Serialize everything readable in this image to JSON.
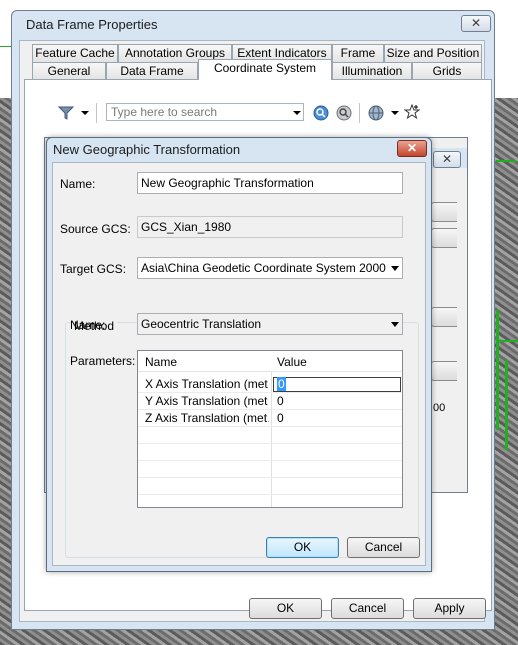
{
  "main_window": {
    "title": "Data Frame Properties",
    "close_glyph": "✕",
    "tabs_row1": [
      "Feature Cache",
      "Annotation Groups",
      "Extent Indicators",
      "Frame",
      "Size and Position"
    ],
    "tabs_row2": [
      "General",
      "Data Frame",
      "Coordinate System",
      "Illumination",
      "Grids"
    ],
    "active_tab": "Coordinate System",
    "search": {
      "placeholder": "Type here to search"
    },
    "toolbar_icons": [
      "filter-icon",
      "search-icon",
      "clear-search-icon",
      "globe-icon",
      "add-favorite-icon"
    ],
    "buttons": {
      "ok": "OK",
      "cancel": "Cancel",
      "apply": "Apply"
    }
  },
  "background_dialog": {
    "close_glyph": "✕",
    "partial_text": "00"
  },
  "transformation_dialog": {
    "title": "New Geographic Transformation",
    "close_glyph": "✕",
    "name_label": "Name:",
    "name_value": "New Geographic Transformation",
    "source_label": "Source GCS:",
    "source_value": "GCS_Xian_1980",
    "target_label": "Target GCS:",
    "target_value": "Asia\\China Geodetic Coordinate System 2000",
    "method_group_label": "Method",
    "method_name_label": "Name:",
    "method_value": "Geocentric Translation",
    "parameters_label": "Parameters:",
    "grid": {
      "columns": [
        "Name",
        "Value"
      ],
      "rows": [
        {
          "name": "X Axis Translation (met…",
          "value": "0"
        },
        {
          "name": "Y Axis Translation (met…",
          "value": "0"
        },
        {
          "name": "Z Axis Translation (met…",
          "value": "0"
        }
      ]
    },
    "buttons": {
      "ok": "OK",
      "cancel": "Cancel"
    }
  }
}
